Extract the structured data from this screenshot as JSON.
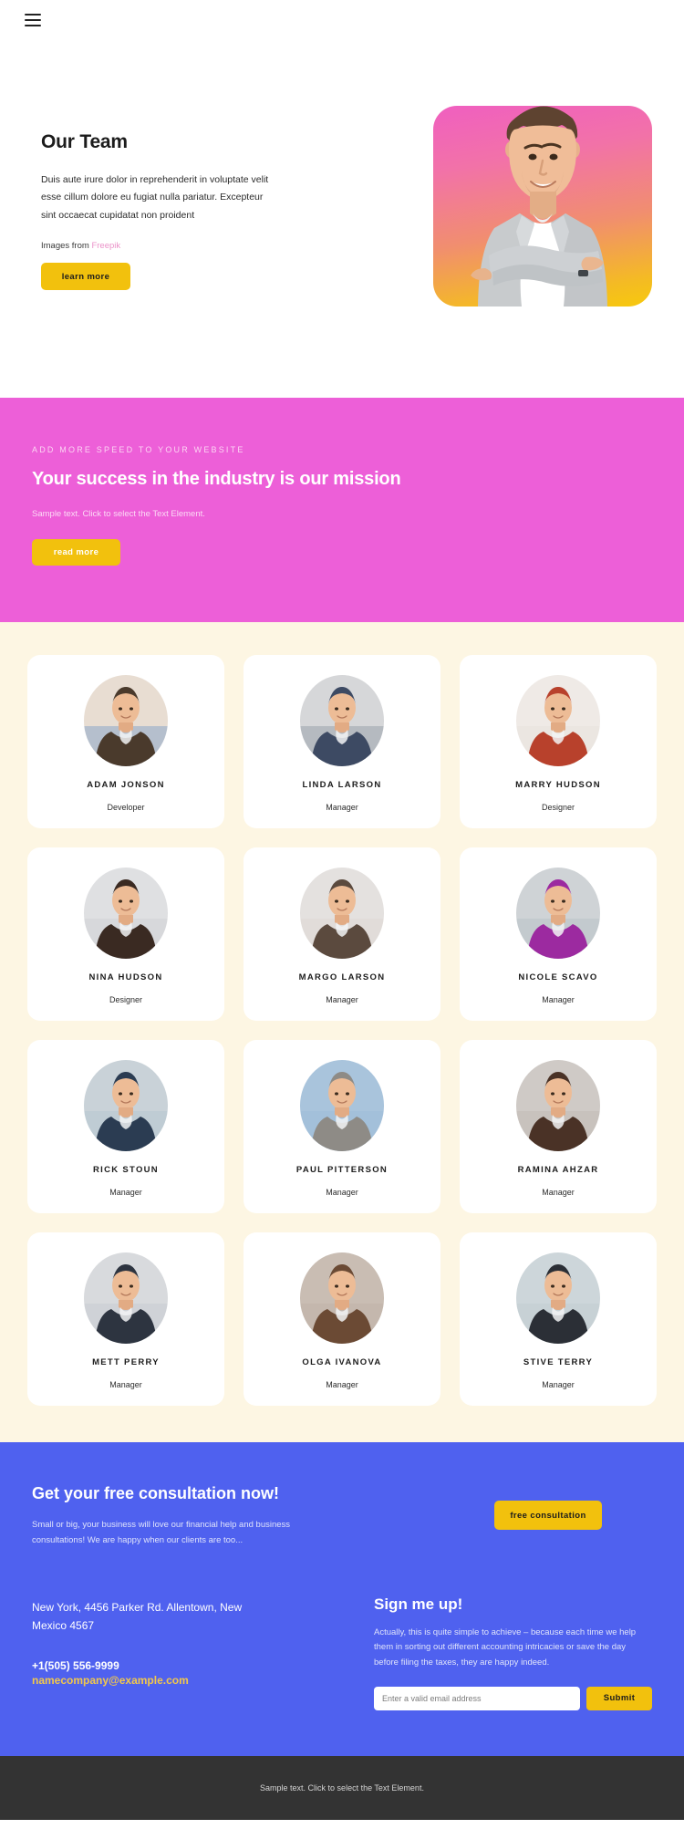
{
  "header": {
    "menu_icon": "hamburger-menu-icon"
  },
  "hero": {
    "title": "Our Team",
    "description": "Duis aute irure dolor in reprehenderit in voluptate velit esse cillum dolore eu fugiat nulla pariatur. Excepteur sint occaecat cupidatat non proident",
    "credit_prefix": "Images from ",
    "credit_link": "Freepik",
    "button_label": "learn more",
    "image_alt": "businessman-with-crossed-arms",
    "gradient_from": "#f05fc0",
    "gradient_to": "#f7c90d"
  },
  "banner": {
    "eyebrow": "ADD MORE SPEED TO YOUR WEBSITE",
    "title": "Your success in the industry is our mission",
    "subtitle": "Sample text. Click to select the Text Element.",
    "button_label": "read more",
    "background": "#ed5fd8"
  },
  "team": {
    "background": "#fdf6e3",
    "members": [
      {
        "name": "ADAM JONSON",
        "role": "Developer",
        "photo": "man-writing-at-desk",
        "bg": "#e8ddd2"
      },
      {
        "name": "LINDA LARSON",
        "role": "Manager",
        "photo": "two-women-at-office-desk",
        "bg": "#d6d7d9"
      },
      {
        "name": "MARRY HUDSON",
        "role": "Designer",
        "photo": "woman-with-red-braid",
        "bg": "#efeae6"
      },
      {
        "name": "NINA HUDSON",
        "role": "Designer",
        "photo": "woman-with-laptop",
        "bg": "#dfe0e2"
      },
      {
        "name": "MARGO LARSON",
        "role": "Manager",
        "photo": "smiling-short-hair-woman",
        "bg": "#e4e1df"
      },
      {
        "name": "NICOLE SCAVO",
        "role": "Manager",
        "photo": "woman-in-purple-blazer",
        "bg": "#cfd3d6"
      },
      {
        "name": "RICK STOUN",
        "role": "Manager",
        "photo": "men-in-meeting",
        "bg": "#c9d2d8"
      },
      {
        "name": "PAUL PITTERSON",
        "role": "Manager",
        "photo": "senior-man-on-phone",
        "bg": "#a9c4dc"
      },
      {
        "name": "RAMINA AHZAR",
        "role": "Manager",
        "photo": "curly-hair-woman",
        "bg": "#cfcac6"
      },
      {
        "name": "METT PERRY",
        "role": "Manager",
        "photo": "man-with-glasses-and-tie",
        "bg": "#d8dadd"
      },
      {
        "name": "OLGA IVANOVA",
        "role": "Manager",
        "photo": "woman-brown-bob-haircut",
        "bg": "#c9bdb3"
      },
      {
        "name": "STIVE TERRY",
        "role": "Manager",
        "photo": "thinking-man-white-shirt",
        "bg": "#cdd6da"
      }
    ]
  },
  "cta": {
    "background": "#4f61ef",
    "title": "Get your free consultation now!",
    "description": "Small or big, your business will love our financial help and business consultations! We are happy when our clients are too...",
    "button_label": "free consultation"
  },
  "contact": {
    "address": "New York, 4456 Parker Rd. Allentown, New Mexico 4567",
    "phone": "+1(505) 556-9999",
    "email": "namecompany@example.com",
    "email_color": "#f2c84b"
  },
  "signup": {
    "title": "Sign me up!",
    "description": "Actually, this is quite simple to achieve – because each time we help them in sorting out different accounting intricacies or save the day before filing the taxes, they are happy indeed.",
    "input_placeholder": "Enter a valid email address",
    "input_value": "",
    "submit_label": "Submit"
  },
  "footer": {
    "text": "Sample text. Click to select the Text Element.",
    "background": "#333333"
  }
}
